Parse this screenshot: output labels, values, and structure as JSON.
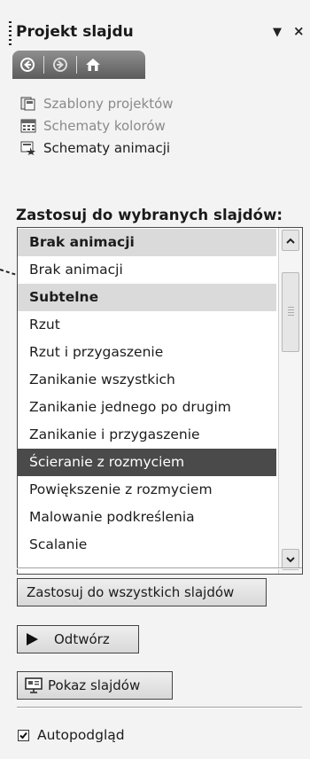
{
  "pane": {
    "title": "Projekt slajdu",
    "dropdown_glyph": "▼",
    "close_glyph": "×"
  },
  "nav": {
    "back_icon": "back-arrow-icon",
    "forward_icon": "forward-arrow-icon",
    "home_icon": "home-icon"
  },
  "links": [
    {
      "label": "Szablony projektów",
      "icon": "design-templates-icon",
      "enabled": false
    },
    {
      "label": "Schematy kolorów",
      "icon": "color-schemes-icon",
      "enabled": false
    },
    {
      "label": "Schematy animacji",
      "icon": "animation-schemes-icon",
      "enabled": true
    }
  ],
  "apply_label": "Zastosuj do wybranych slajdów:",
  "list": {
    "items": [
      {
        "label": "Brak animacji",
        "type": "group"
      },
      {
        "label": "Brak animacji",
        "type": "item"
      },
      {
        "label": "Subtelne",
        "type": "group"
      },
      {
        "label": "Rzut",
        "type": "item"
      },
      {
        "label": "Rzut i przygaszenie",
        "type": "item"
      },
      {
        "label": "Zanikanie wszystkich",
        "type": "item"
      },
      {
        "label": "Zanikanie jednego po drugim",
        "type": "item"
      },
      {
        "label": "Zanikanie i przygaszenie",
        "type": "item"
      },
      {
        "label": "Ścieranie z rozmyciem",
        "type": "item",
        "selected": true
      },
      {
        "label": "Powiększenie z rozmyciem",
        "type": "item"
      },
      {
        "label": "Malowanie podkreślenia",
        "type": "item"
      },
      {
        "label": "Scalanie",
        "type": "item"
      }
    ]
  },
  "buttons": {
    "apply_all": "Zastosuj do wszystkich slajdów",
    "play": "Odtwórz",
    "slideshow": "Pokaz slajdów"
  },
  "autopreview": {
    "label": "Autopodgląd",
    "checked": true
  }
}
